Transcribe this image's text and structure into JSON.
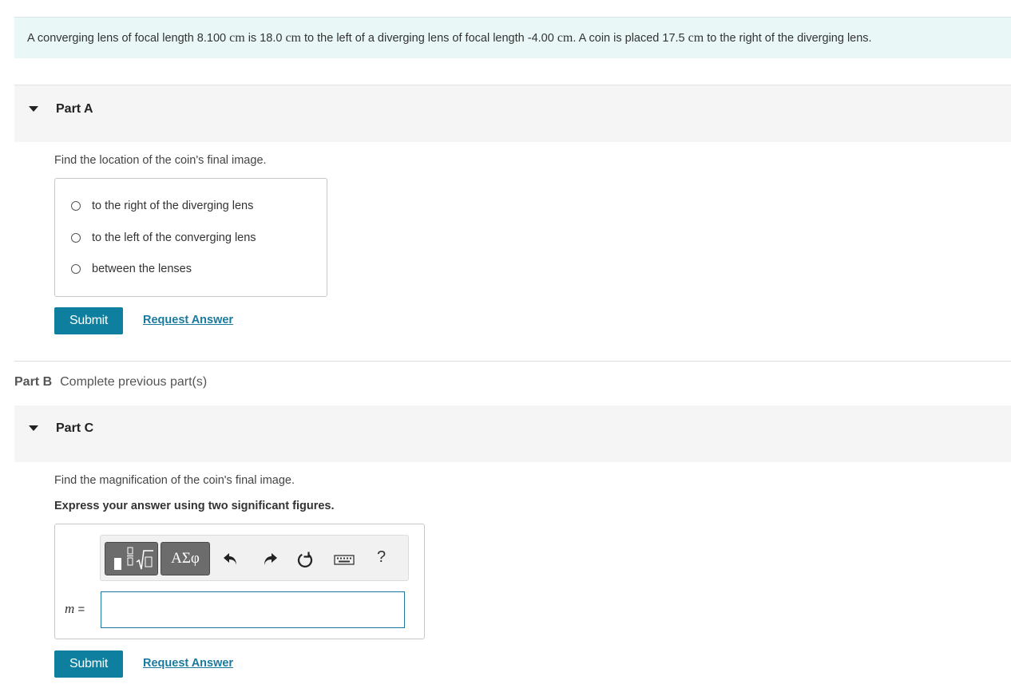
{
  "problem": {
    "t1": "A converging lens of focal length 8.100 ",
    "u1": "cm",
    "t2": " is 18.0 ",
    "u2": "cm",
    "t3": " to the left of a diverging lens of focal length -4.00 ",
    "u3": "cm",
    "t4": ". A coin is placed 17.5 ",
    "u4": "cm",
    "t5": " to the right of the diverging lens."
  },
  "partA": {
    "title": "Part A",
    "question": "Find the location of the coin's final image.",
    "choices": [
      {
        "label": "to the right of the diverging lens"
      },
      {
        "label": "to the left of the converging lens"
      },
      {
        "label": "between the lenses"
      }
    ],
    "submit": "Submit",
    "request": "Request Answer"
  },
  "partB": {
    "title": "Part B",
    "status": "Complete previous part(s)"
  },
  "partC": {
    "title": "Part C",
    "question": "Find the magnification of the coin's final image.",
    "instruction": "Express your answer using two significant figures.",
    "variable": "m",
    "equals": " =",
    "input_value": "",
    "toolbar": {
      "greek": "ΑΣφ",
      "help": "?"
    },
    "submit": "Submit",
    "request": "Request Answer"
  },
  "colors": {
    "accent": "#0e7f9e",
    "link": "#1a7a9e",
    "problem_bg": "#e9f7f7",
    "part_header_bg": "#f5f5f5"
  }
}
